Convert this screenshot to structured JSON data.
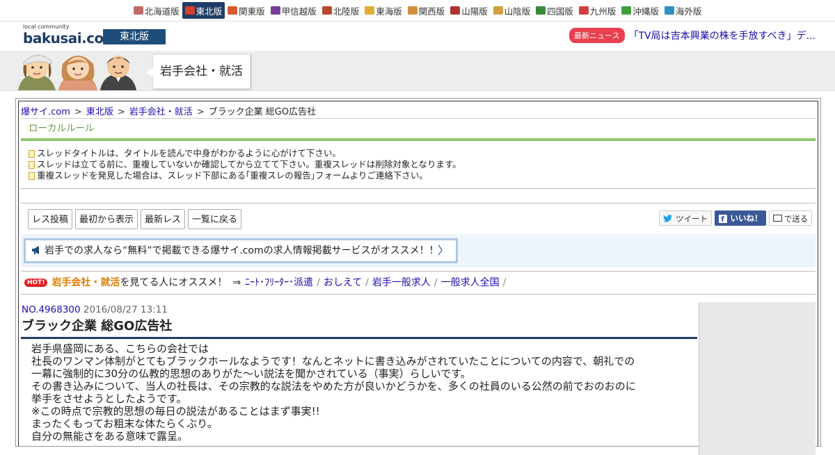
{
  "regions": [
    {
      "label": "北海道版",
      "color": "#c06a6a",
      "active": false
    },
    {
      "label": "東北版",
      "color": "#d6402c",
      "active": true
    },
    {
      "label": "関東版",
      "color": "#d85a30",
      "active": false
    },
    {
      "label": "甲信越版",
      "color": "#7a3c9a",
      "active": false
    },
    {
      "label": "北陸版",
      "color": "#b8492c",
      "active": false
    },
    {
      "label": "東海版",
      "color": "#e0b030",
      "active": false
    },
    {
      "label": "関西版",
      "color": "#d09040",
      "active": false
    },
    {
      "label": "山陽版",
      "color": "#b03030",
      "active": false
    },
    {
      "label": "山陰版",
      "color": "#d0a040",
      "active": false
    },
    {
      "label": "四国版",
      "color": "#3a8a3a",
      "active": false
    },
    {
      "label": "九州版",
      "color": "#d04040",
      "active": false
    },
    {
      "label": "沖縄版",
      "color": "#40a040",
      "active": false
    },
    {
      "label": "海外版",
      "color": "#3090c0",
      "active": false
    }
  ],
  "header": {
    "logo_small": "local community",
    "logo_big": "bakusai.com",
    "edition": "東北版",
    "news_badge": "最新ニュース",
    "news_text": "「TV局は吉本興業の株を手放すべき」デ..."
  },
  "banner": {
    "category": "岩手会社・就活"
  },
  "breadcrumb": [
    "爆サイ.com",
    "東北版",
    "岩手会社・就活",
    "ブラック企業 総GO広告社"
  ],
  "local_rule": {
    "heading": "ローカルルール",
    "items": [
      "スレッドタイトルは、タイトルを読んで中身がわかるように心がけて下さい。",
      "スレッドは立てる前に、重複していないか確認してから立てて下さい。重複スレッドは削除対象となります。",
      "重複スレッドを発見した場合は、スレッド下部にある｢重複スレの報告｣フォームよりご連絡下さい。"
    ]
  },
  "buttons": {
    "post": "レス投稿",
    "from_start": "最初から表示",
    "latest": "最新レス",
    "back": "一覧に戻る"
  },
  "share": {
    "tweet": "ツイート",
    "like": "いいね！",
    "mail": "で送る"
  },
  "promo": {
    "text": "岩手での求人なら“無料”で掲載できる爆サイ.comの求人情報掲載サービスがオススメ！！",
    "chevron": "〉"
  },
  "hot": {
    "badge": "HOT!",
    "category": "岩手会社・就活",
    "suffix": "を見てる人にオススメ！",
    "arrow": "⇒",
    "links": [
      "ﾆｰﾄ･ﾌﾘｰﾀｰ･派遣",
      "おしえて",
      "岩手一般求人",
      "一般求人全国"
    ]
  },
  "post": {
    "number": "NO.4968300",
    "date": "2016/08/27 13:11",
    "title": "ブラック企業 総GO広告社",
    "lines": [
      "岩手県盛岡にある、こちらの会社では",
      "社長のワンマン体制がとてもブラックホールなようです！なんとネットに書き込みがされていたことについての内容で、朝礼での",
      "一幕に強制的に30分の仏教的思想のありがた～い説法を聞かされている（事実）らしいです。",
      "その書き込みについて、当人の社長は、その宗教的な説法をやめた方が良いかどうかを、多くの社員のいる公然の前でおのおのに",
      "挙手をさせようとしたようです。",
      "※この時点で宗教的思想の毎日の説法があることはまず事実!!",
      "まったくもってお粗末な体たらくぶり。",
      "自分の無能さをある意味で露呈。"
    ]
  }
}
